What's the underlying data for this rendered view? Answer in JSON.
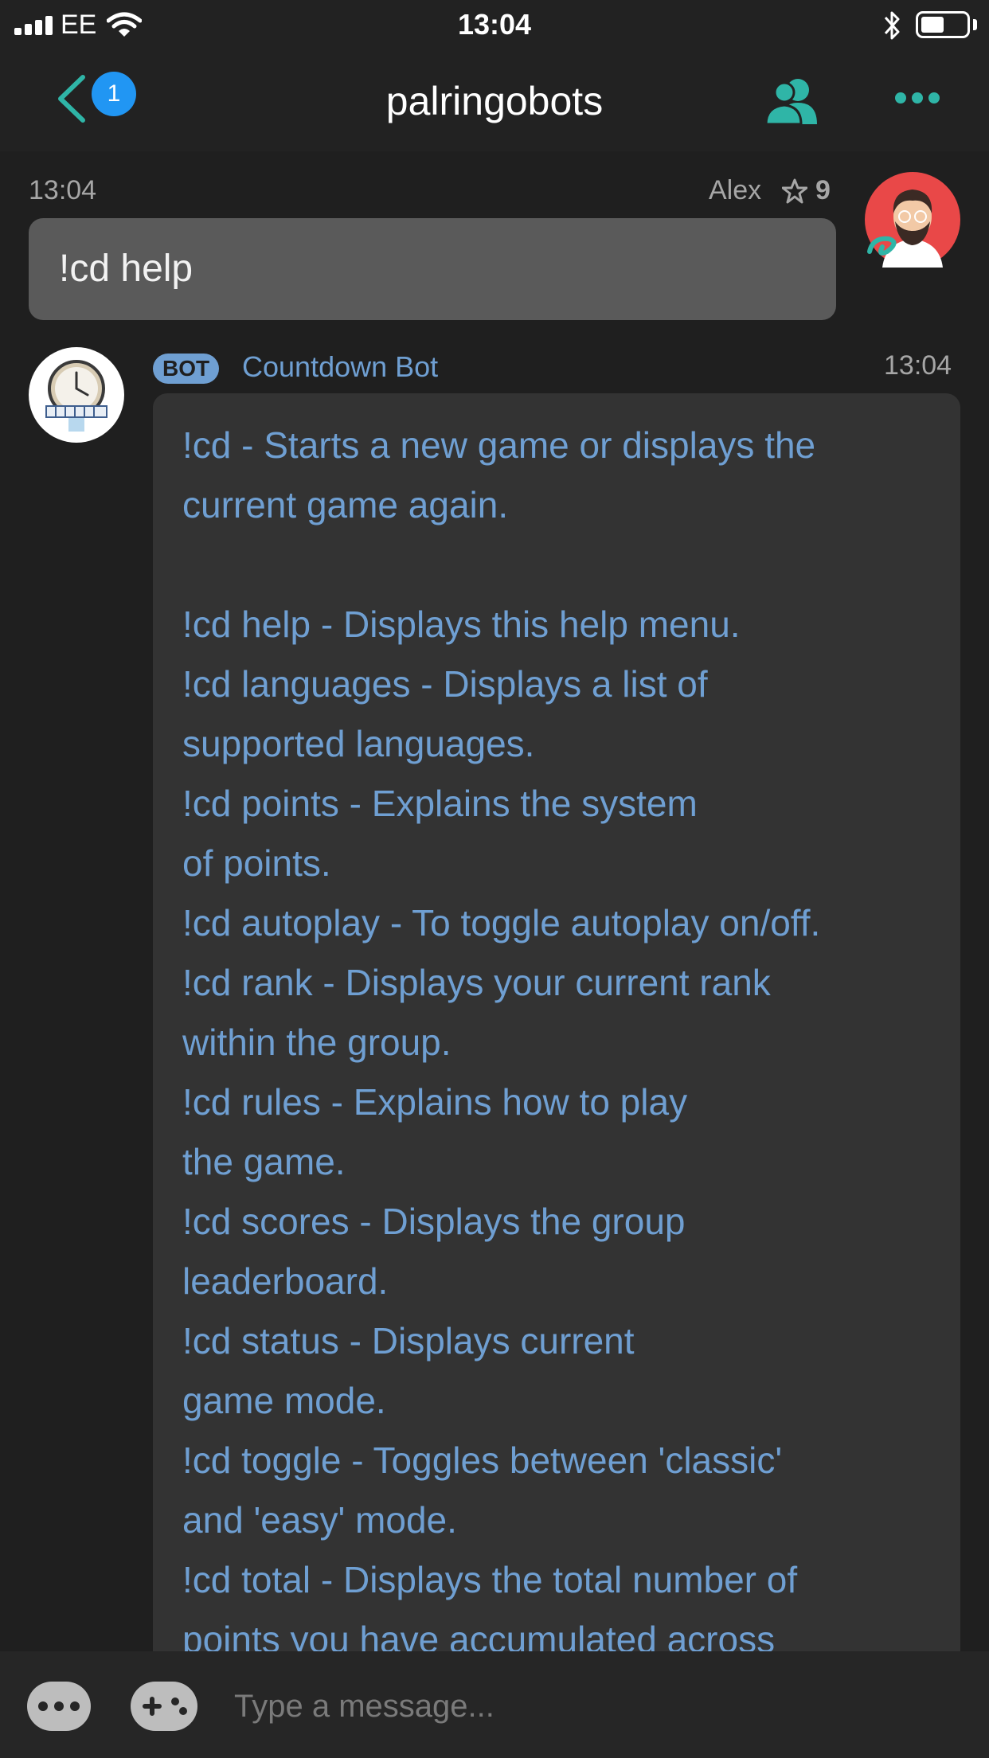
{
  "status_bar": {
    "carrier": "EE",
    "time": "13:04",
    "battery_level": 0.5
  },
  "nav": {
    "back_badge": "1",
    "title": "palringobots"
  },
  "messages": [
    {
      "time": "13:04",
      "sender": "Alex",
      "stars": "9",
      "text": "!cd help"
    },
    {
      "badge": "BOT",
      "sender": "Countdown Bot",
      "time": "13:04",
      "lines": [
        "!cd - Starts a new game or displays the",
        "current game again.",
        "",
        "!cd help - Displays this help menu.",
        "!cd languages - Displays a list of",
        "supported languages.",
        "!cd points - Explains the system",
        "of points.",
        "!cd autoplay - To toggle autoplay on/off.",
        "!cd rank - Displays your current rank",
        "within the group.",
        "!cd rules - Explains how to play",
        "the game.",
        "!cd scores - Displays the group",
        "leaderboard.",
        "!cd status - Displays current",
        "game mode.",
        "!cd toggle - Toggles between 'classic'",
        "and 'easy' mode.",
        "!cd total - Displays the total number of",
        "points you have accumulated across"
      ]
    }
  ],
  "input": {
    "placeholder": "Type a message..."
  },
  "colors": {
    "accent": "#2fb5a7",
    "badge": "#2196f3",
    "bot_text": "#6f9fd2",
    "user_bubble": "#5a5a5a",
    "bot_bubble": "#333333"
  },
  "icons": [
    "signal-icon",
    "wifi-icon",
    "bluetooth-icon",
    "battery-icon",
    "back-chevron-icon",
    "members-icon",
    "more-icon",
    "star-icon",
    "more-options-icon",
    "gamepad-icon"
  ]
}
